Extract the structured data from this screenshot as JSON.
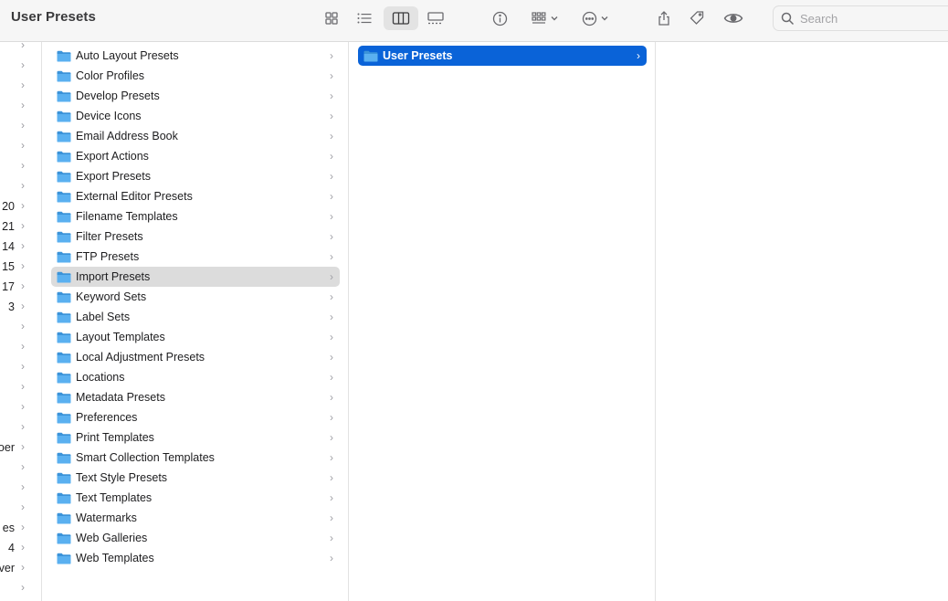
{
  "window": {
    "title": "User Presets"
  },
  "toolbar": {
    "search_placeholder": "Search"
  },
  "column0": {
    "rows": [
      {
        "text": ""
      },
      {
        "text": ""
      },
      {
        "text": ""
      },
      {
        "text": ""
      },
      {
        "text": ""
      },
      {
        "text": ""
      },
      {
        "text": ""
      },
      {
        "text": ""
      },
      {
        "text": "20"
      },
      {
        "text": "21"
      },
      {
        "text": "14"
      },
      {
        "text": "15"
      },
      {
        "text": "17"
      },
      {
        "text": "3"
      },
      {
        "text": ""
      },
      {
        "text": ""
      },
      {
        "text": ""
      },
      {
        "text": ""
      },
      {
        "text": ""
      },
      {
        "text": ""
      },
      {
        "text": "oer"
      },
      {
        "text": ""
      },
      {
        "text": ""
      },
      {
        "text": ""
      },
      {
        "text": "es"
      },
      {
        "text": "4"
      },
      {
        "text": "ver"
      },
      {
        "text": ""
      }
    ]
  },
  "column1": {
    "items": [
      {
        "label": "Auto Layout Presets"
      },
      {
        "label": "Color Profiles"
      },
      {
        "label": "Develop Presets"
      },
      {
        "label": "Device Icons"
      },
      {
        "label": "Email Address Book"
      },
      {
        "label": "Export Actions"
      },
      {
        "label": "Export Presets"
      },
      {
        "label": "External Editor Presets"
      },
      {
        "label": "Filename Templates"
      },
      {
        "label": "Filter Presets"
      },
      {
        "label": "FTP Presets"
      },
      {
        "label": "Import Presets",
        "selected": true
      },
      {
        "label": "Keyword Sets"
      },
      {
        "label": "Label Sets"
      },
      {
        "label": "Layout Templates"
      },
      {
        "label": "Local Adjustment Presets"
      },
      {
        "label": "Locations"
      },
      {
        "label": "Metadata Presets"
      },
      {
        "label": "Preferences"
      },
      {
        "label": "Print Templates"
      },
      {
        "label": "Smart Collection Templates"
      },
      {
        "label": "Text Style Presets"
      },
      {
        "label": "Text Templates"
      },
      {
        "label": "Watermarks"
      },
      {
        "label": "Web Galleries"
      },
      {
        "label": "Web Templates"
      }
    ]
  },
  "column2": {
    "items": [
      {
        "label": "User Presets",
        "selected": true
      }
    ]
  },
  "colors": {
    "accent": "#0a63d8",
    "folder": "#5ab0f0",
    "selection_inactive": "#dcdcdc"
  },
  "icons": [
    "icon-view-icon",
    "list-view-icon",
    "column-view-icon",
    "gallery-view-icon",
    "info-icon",
    "group-icon",
    "more-icon",
    "share-icon",
    "tag-icon",
    "eye-icon",
    "search-icon",
    "folder-icon",
    "chevron-right-icon"
  ]
}
